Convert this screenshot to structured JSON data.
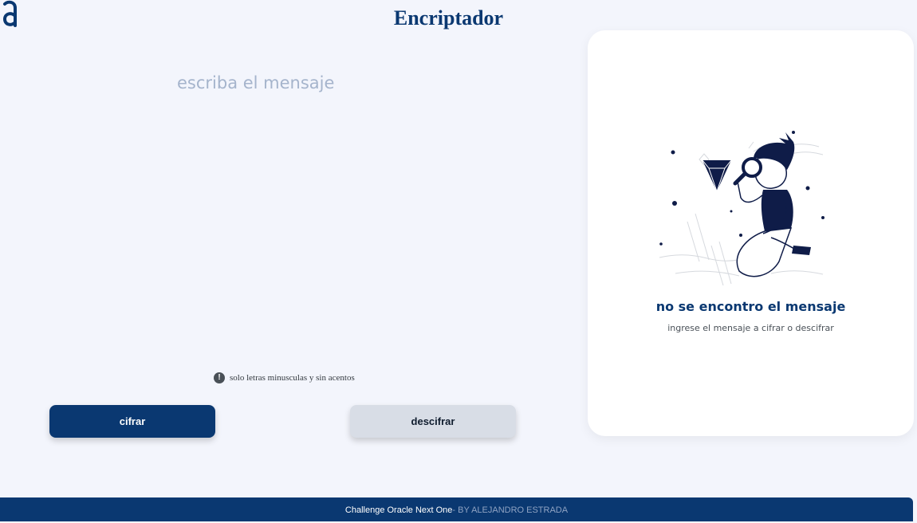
{
  "header": {
    "logo_icon": "alura-logo-icon",
    "title": "Encriptador"
  },
  "editor": {
    "placeholder": "escriba el mensaje",
    "value": ""
  },
  "hint": {
    "icon": "exclamation-circle-icon",
    "text": "solo letras minusculas y sin acentos"
  },
  "buttons": {
    "encrypt_label": "cifrar",
    "decrypt_label": "descifrar"
  },
  "result_panel": {
    "illustration": "person-with-magnifying-glass-illustration",
    "title": "no se encontro el mensaje",
    "subtitle": "ingrese el mensaje a cifrar o descifrar"
  },
  "footer": {
    "main_text": "Challenge Oracle Next One",
    "author_text": "- BY ALEJANDRO ESTRADA"
  },
  "colors": {
    "primary": "#0a3871",
    "background": "#f3f5fc",
    "card": "#ffffff",
    "secondary_button": "#d8dde6",
    "placeholder": "#a5b4cc"
  }
}
